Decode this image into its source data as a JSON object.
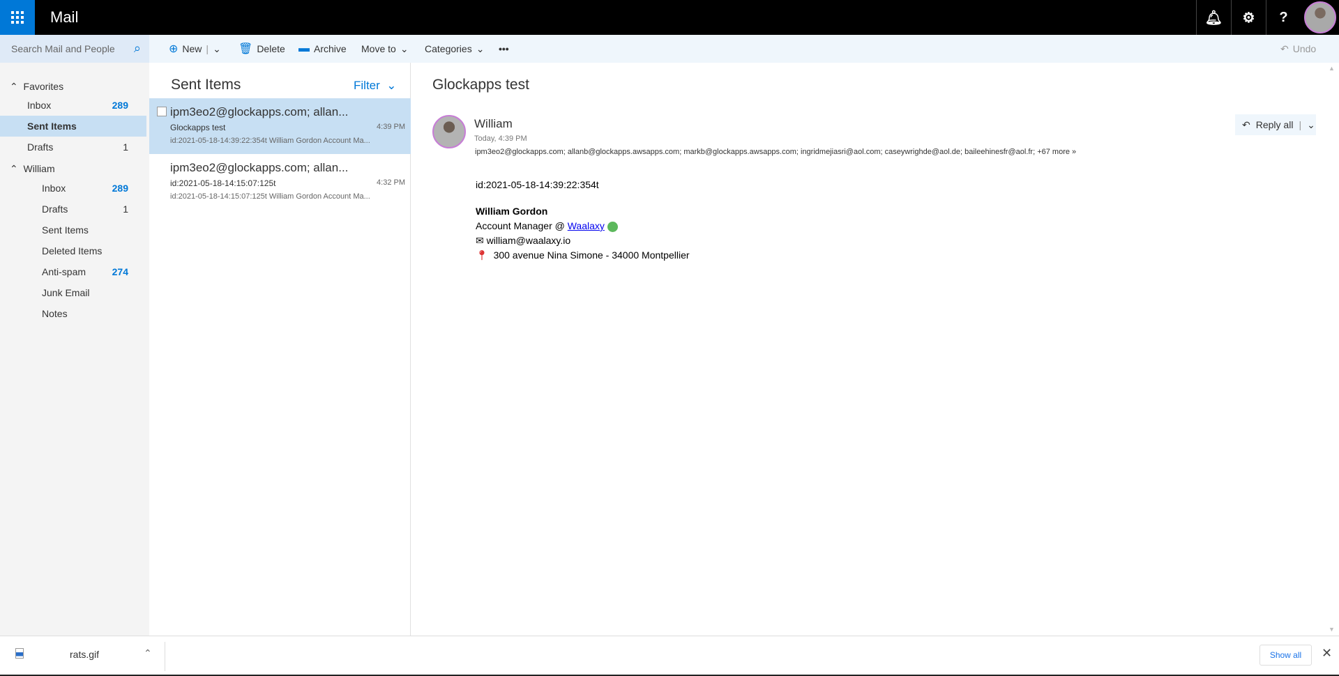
{
  "app": {
    "title": "Mail"
  },
  "search": {
    "placeholder": "Search Mail and People"
  },
  "toolbar": {
    "new": "New",
    "delete": "Delete",
    "archive": "Archive",
    "move_to": "Move to",
    "categories": "Categories",
    "more": "•••",
    "undo": "Undo"
  },
  "sidebar": {
    "favorites": "Favorites",
    "fav_items": [
      {
        "label": "Inbox",
        "count": "289"
      },
      {
        "label": "Sent Items",
        "count": ""
      },
      {
        "label": "Drafts",
        "count": "1"
      }
    ],
    "account": "William",
    "acc_items": [
      {
        "label": "Inbox",
        "count": "289"
      },
      {
        "label": "Drafts",
        "count": "1"
      },
      {
        "label": "Sent Items",
        "count": ""
      },
      {
        "label": "Deleted Items",
        "count": ""
      },
      {
        "label": "Anti-spam",
        "count": "274"
      },
      {
        "label": "Junk Email",
        "count": ""
      },
      {
        "label": "Notes",
        "count": ""
      }
    ]
  },
  "list": {
    "title": "Sent Items",
    "filter": "Filter",
    "messages": [
      {
        "from": "ipm3eo2@glockapps.com; allan...",
        "subject": "Glockapps test",
        "time": "4:39 PM",
        "preview": "id:2021-05-18-14:39:22:354t William Gordon Account Ma..."
      },
      {
        "from": "ipm3eo2@glockapps.com; allan...",
        "subject": "id:2021-05-18-14:15:07:125t",
        "time": "4:32 PM",
        "preview": "id:2021-05-18-14:15:07:125t William Gordon Account Ma..."
      }
    ]
  },
  "reading": {
    "subject": "Glockapps test",
    "sender": "William",
    "date": "Today, 4:39 PM",
    "recipients": "ipm3eo2@glockapps.com;  allanb@glockapps.awsapps.com;  markb@glockapps.awsapps.com;  ingridmejiasri@aol.com;  caseywrighde@aol.de;  baileehinesfr@aol.fr;  +67 more",
    "reply_all": "Reply all",
    "body": {
      "id": "id:2021-05-18-14:39:22:354t",
      "name": "William Gordon",
      "role": "Account Manager @ ",
      "company": "Waalaxy",
      "email": "william@waalaxy.io",
      "address": "300 avenue Nina Simone - 34000 Montpellier"
    }
  },
  "downloads": {
    "file": "rats.gif",
    "show_all": "Show all"
  }
}
